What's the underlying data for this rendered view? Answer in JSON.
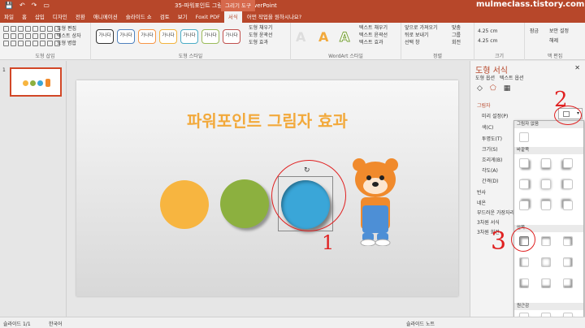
{
  "titlebar": {
    "doc_title": "35-파워포인트 그림자 효과 - PowerPoint",
    "context_tab": "그리기 도구",
    "watermark": "mulmeclass.tistory.com"
  },
  "tabs": [
    "파일",
    "홈",
    "삽입",
    "디자인",
    "전환",
    "애니메이션",
    "슬라이드 쇼",
    "검토",
    "보기",
    "Foxit PDF",
    "서식"
  ],
  "active_tab": "서식",
  "tell_me": "어떤 작업을 원하시나요?",
  "ribbon": {
    "insert_shapes": {
      "label": "도형 삽입",
      "edit_shape": "도형 편집",
      "textbox": "텍스트 상자",
      "merge": "도형 병합"
    },
    "shape_styles": {
      "label": "도형 스타일",
      "style_text": "가나다",
      "fill": "도형 채우기",
      "outline": "도형 윤곽선",
      "effects": "도형 효과"
    },
    "wordart": {
      "label": "WordArt 스타일",
      "text_fill": "텍스트 채우기",
      "text_outline": "텍스트 윤곽선",
      "text_effects": "텍스트 효과"
    },
    "arrange": {
      "label": "정렬",
      "bring_forward": "앞으로 가져오기",
      "send_backward": "뒤로 보내기",
      "selection": "선택 창",
      "align": "맞춤",
      "group": "그룹",
      "rotate": "회전"
    },
    "size": {
      "label": "크기",
      "height": "4.25 cm",
      "width": "4.25 cm"
    },
    "mcafee": {
      "label": "맥 편집",
      "items": [
        "잠금",
        "보안 설정",
        "해제"
      ]
    }
  },
  "slide_pane": {
    "slide_number": "1"
  },
  "slide": {
    "title": "파워포인트 그림자 효과"
  },
  "colors": {
    "orange": "#f7b540",
    "green": "#8cb03f",
    "blue": "#3aa6d8",
    "accent": "#b7472a"
  },
  "format_pane": {
    "title": "도형 서식",
    "subtabs": [
      "도형 옵션",
      "텍스트 옵션"
    ],
    "section": "그림자",
    "props": [
      "미리 설정(P)",
      "색(C)",
      "투명도(T)",
      "크기(S)",
      "흐리게(B)",
      "각도(A)",
      "간격(D)"
    ],
    "collapsed_sections": [
      "반사",
      "네온",
      "부드러운 가장자리",
      "3차원 서식",
      "3차원 회전"
    ]
  },
  "gallery": {
    "groups": [
      "그림자 없음",
      "바깥쪽",
      "안쪽",
      "원근감"
    ]
  },
  "status": {
    "slide": "슬라이드 1/1",
    "language": "한국어",
    "notes": "슬라이드 노트"
  },
  "annotations": [
    "2",
    "1",
    "3"
  ]
}
